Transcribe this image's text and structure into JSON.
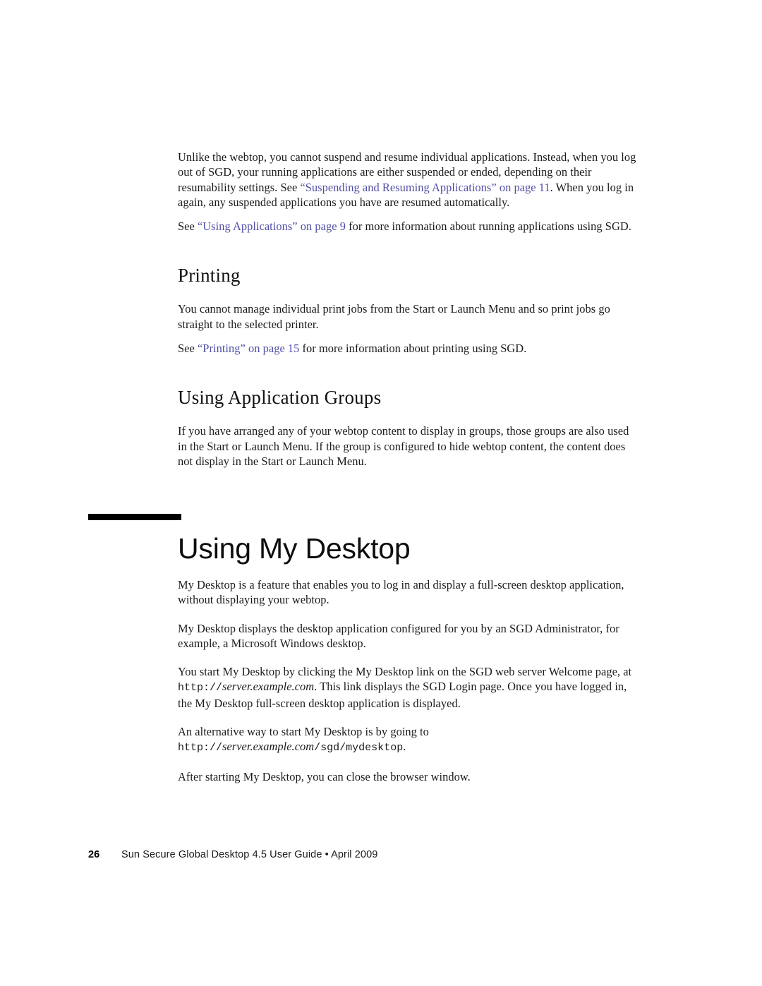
{
  "document": {
    "page_number": "26",
    "footer_text": "Sun Secure Global Desktop 4.5 User Guide • April 2009",
    "link_color": "#4f4fa6",
    "text_color": "#1a1a1a",
    "rule_color": "#000000"
  },
  "intro": {
    "para1_a": "Unlike the webtop, you cannot suspend and resume individual applications. Instead, when you log out of SGD, your running applications are either suspended or ended, depending on their resumability settings. See ",
    "para1_link": "“Suspending and Resuming Applications” on page 11",
    "para1_b": ". When you log in again, any suspended applications you have are resumed automatically.",
    "para2_a": "See ",
    "para2_link": "“Using Applications” on page 9",
    "para2_b": " for more information about running applications using SGD."
  },
  "printing": {
    "heading": "Printing",
    "para1": "You cannot manage individual print jobs from the Start or Launch Menu and so print jobs go straight to the selected printer.",
    "para2_a": "See ",
    "para2_link": "“Printing” on page 15",
    "para2_b": " for more information about printing using SGD."
  },
  "application_groups": {
    "heading": "Using Application Groups",
    "para1": "If you have arranged any of your webtop content to display in groups, those groups are also used in the Start or Launch Menu. If the group is configured to hide webtop content, the content does not display in the Start or Launch Menu."
  },
  "my_desktop": {
    "chapter_title": "Using My Desktop",
    "para1": "My Desktop is a feature that enables you to log in and display a full-screen desktop application, without displaying your webtop.",
    "para2": "My Desktop displays the desktop application configured for you by an SGD Administrator, for example, a Microsoft Windows desktop.",
    "para3_a": "You start My Desktop by clicking the My Desktop link on the SGD web server Welcome page, at ",
    "para3_url_scheme": "http://",
    "para3_url_host": "server.example.com",
    "para3_b": ". This link displays the SGD Login page. Once you have logged in, the My Desktop full-screen desktop application is displayed.",
    "para4_a": "An alternative way to start My Desktop is by going to ",
    "para4_url_scheme": "http://",
    "para4_url_host": "server.example.com",
    "para4_url_path": "/sgd/mydesktop",
    "para4_b": ".",
    "para5": "After starting My Desktop, you can close the browser window."
  }
}
